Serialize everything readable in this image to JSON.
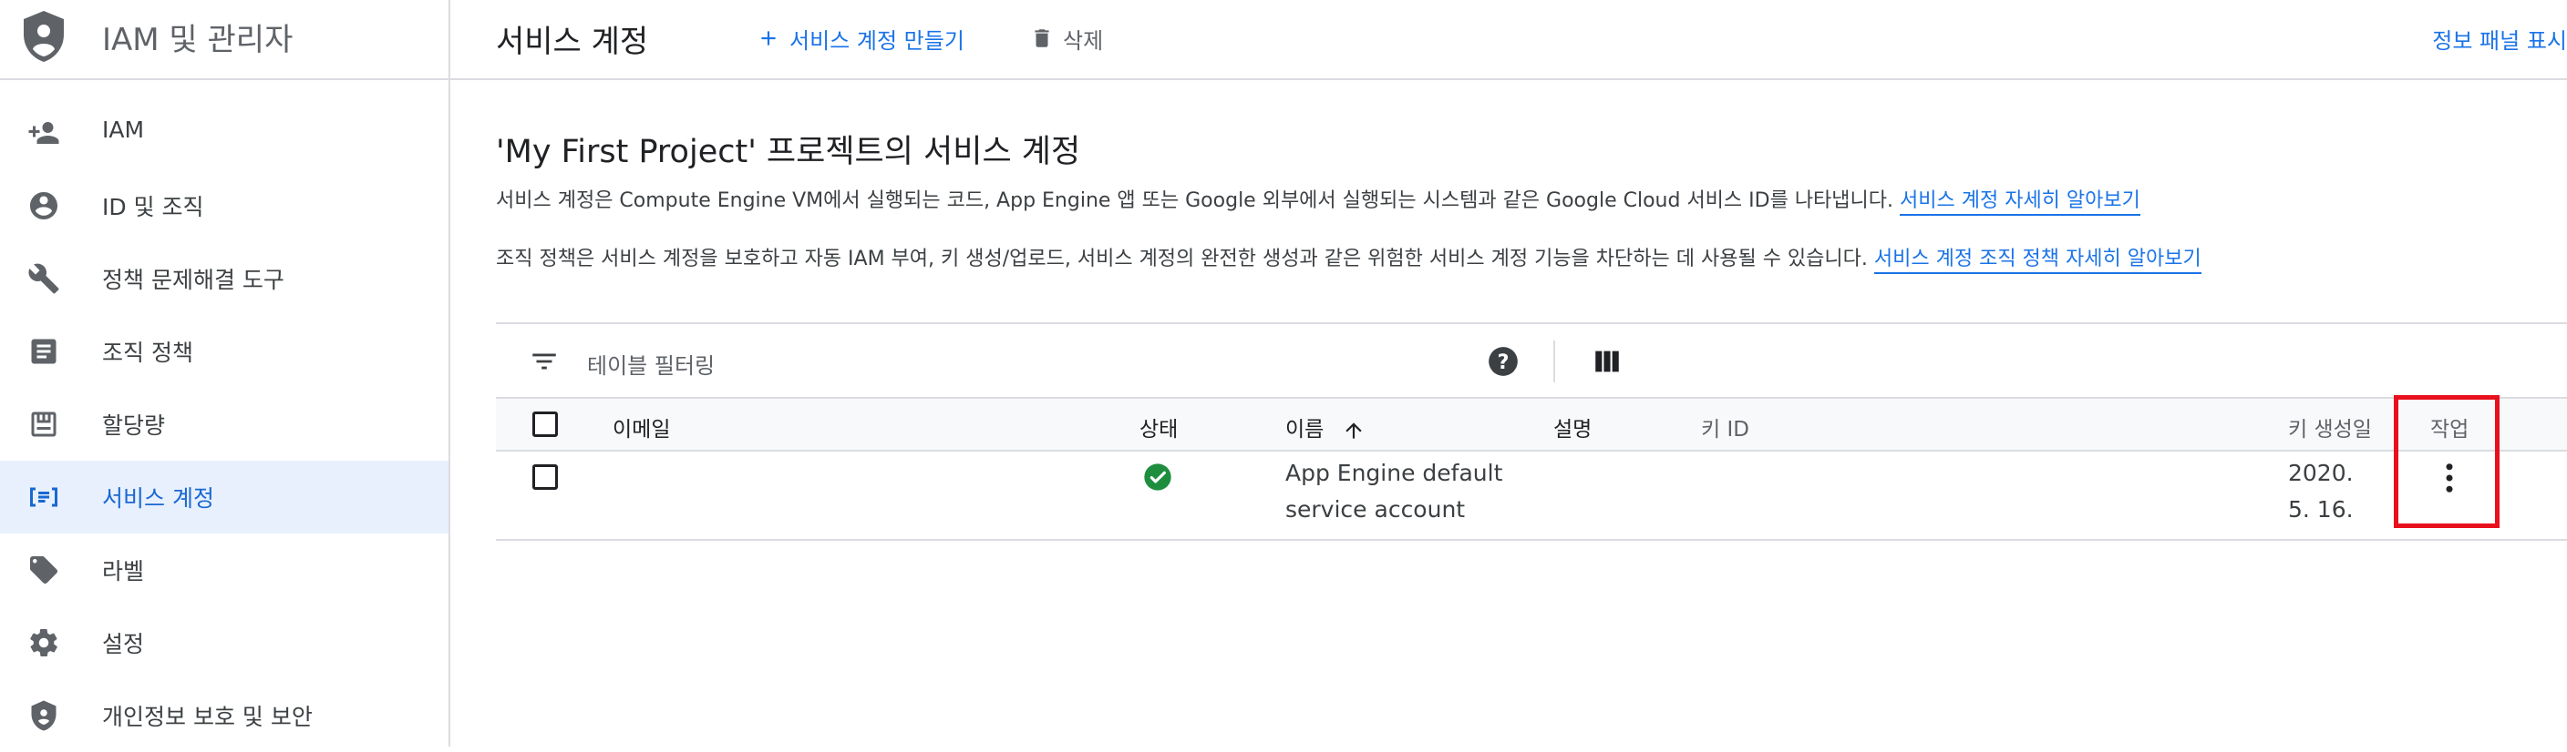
{
  "brand": {
    "title": "IAM 및 관리자",
    "icon": "shield-icon"
  },
  "sidebar": {
    "items": [
      {
        "label": "IAM",
        "icon": "person-add-icon",
        "active": false
      },
      {
        "label": "ID 및 조직",
        "icon": "account-circle-icon",
        "active": false
      },
      {
        "label": "정책 문제해결 도구",
        "icon": "wrench-icon",
        "active": false
      },
      {
        "label": "조직 정책",
        "icon": "document-icon",
        "active": false
      },
      {
        "label": "할당량",
        "icon": "quota-icon",
        "active": false
      },
      {
        "label": "서비스 계정",
        "icon": "service-account-icon",
        "active": true
      },
      {
        "label": "라벨",
        "icon": "label-icon",
        "active": false
      },
      {
        "label": "설정",
        "icon": "gear-icon",
        "active": false
      },
      {
        "label": "개인정보 보호 및 보안",
        "icon": "shield-lock-icon",
        "active": false
      }
    ]
  },
  "topbar": {
    "title": "서비스 계정",
    "create_label": "서비스 계정 만들기",
    "delete_label": "삭제",
    "info_panel_label": "정보 패널 표시"
  },
  "main": {
    "heading": "'My First Project' 프로젝트의 서비스 계정",
    "desc1": "서비스 계정은 Compute Engine VM에서 실행되는 코드, App Engine 앱 또는 Google 외부에서 실행되는 시스템과 같은 Google Cloud 서비스 ID를 나타냅니다.",
    "desc1_link": "서비스 계정 자세히 알아보기",
    "desc2": "조직 정책은 서비스 계정을 보호하고 자동 IAM 부여, 키 생성/업로드, 서비스 계정의 완전한 생성과 같은 위험한 서비스 계정 기능을 차단하는 데 사용될 수 있습니다.",
    "desc2_link": "서비스 계정 조직 정책 자세히 알아보기"
  },
  "table": {
    "filter_placeholder": "테이블 필터링",
    "columns": {
      "email": "이메일",
      "status": "상태",
      "name": "이름",
      "description": "설명",
      "key_id": "키 ID",
      "key_created": "키 생성일",
      "actions": "작업"
    },
    "rows": [
      {
        "email": "",
        "status": "enabled",
        "name_line1": "App Engine default",
        "name_line2": "service account",
        "description": "",
        "key_id": "",
        "key_created_line1": "2020.",
        "key_created_line2": "5. 16."
      }
    ]
  },
  "colors": {
    "accent": "#1a73e8",
    "active_bg": "#e8f0fe",
    "status_ok": "#1e8e3e",
    "highlight": "#e8101c"
  }
}
